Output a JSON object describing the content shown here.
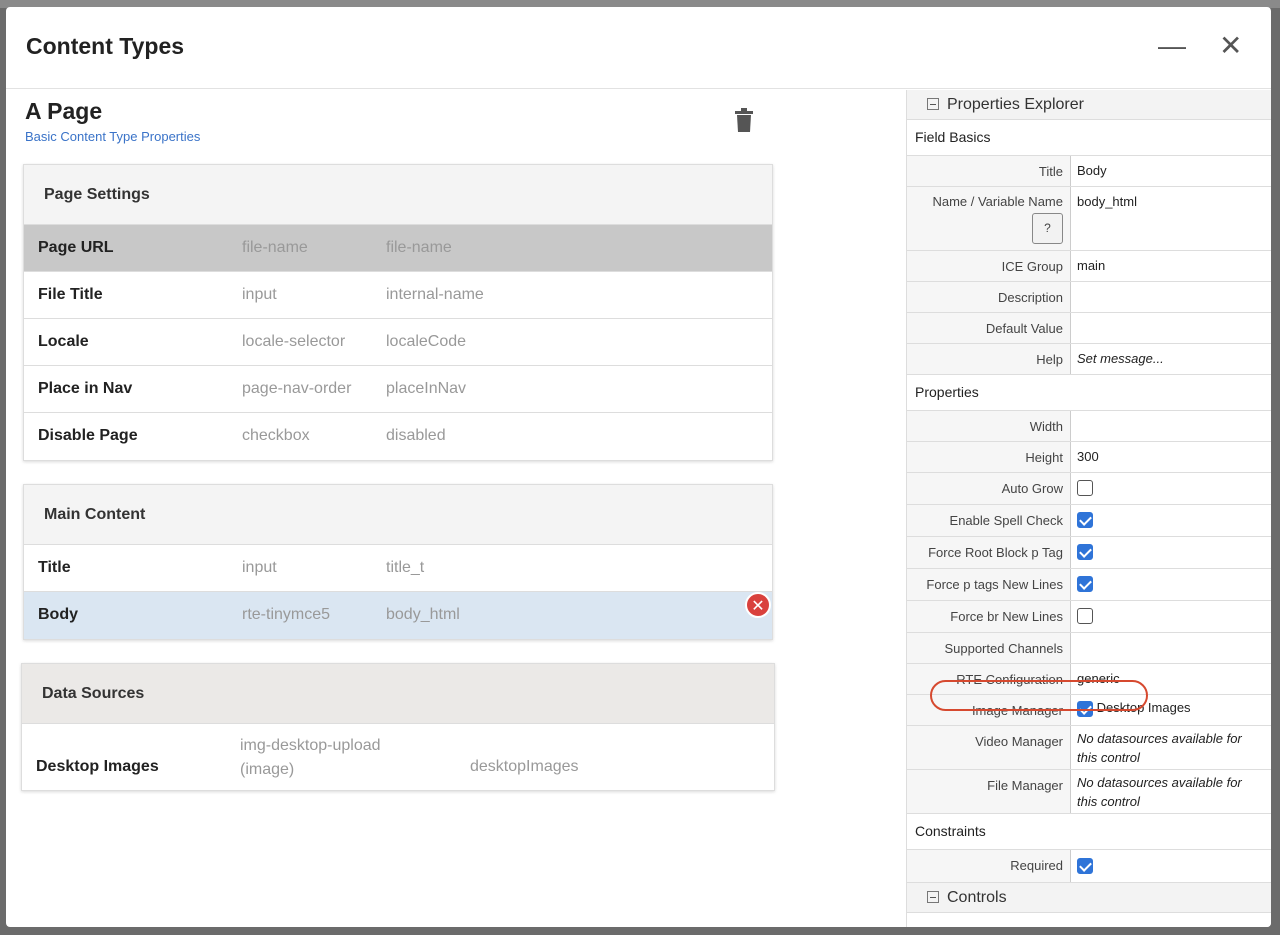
{
  "modal": {
    "title": "Content Types",
    "minimize_icon": "minus-icon",
    "close_icon": "close-icon"
  },
  "page": {
    "title": "A Page",
    "subtitle": "Basic Content Type Properties"
  },
  "sections": [
    {
      "title": "Page Settings",
      "rows": [
        [
          "Page URL",
          "file-name",
          "file-name"
        ],
        [
          "File Title",
          "input",
          "internal-name"
        ],
        [
          "Locale",
          "locale-selector",
          "localeCode"
        ],
        [
          "Place in Nav",
          "page-nav-order",
          "placeInNav"
        ],
        [
          "Disable Page",
          "checkbox",
          "disabled"
        ]
      ]
    },
    {
      "title": "Main Content",
      "rows": [
        [
          "Title",
          "input",
          "title_t"
        ],
        [
          "Body",
          "rte-tinymce5",
          "body_html"
        ]
      ]
    },
    {
      "title": "Data Sources",
      "rows": [
        [
          "Desktop Images",
          "img-desktop-upload (image)",
          "desktopImages"
        ]
      ]
    }
  ],
  "props": {
    "header": "Properties Explorer",
    "field_basics": "Field Basics",
    "title_label": "Title",
    "title_value": "Body",
    "name_label": "Name / Variable Name",
    "name_value": "body_html",
    "ice_label": "ICE Group",
    "ice_value": "main",
    "desc_label": "Description",
    "default_label": "Default Value",
    "help_label": "Help",
    "help_value": "Set message...",
    "properties": "Properties",
    "width_label": "Width",
    "height_label": "Height",
    "height_value": "300",
    "checks": [
      {
        "label": "Auto Grow",
        "checked": false
      },
      {
        "label": "Enable Spell Check",
        "checked": true
      },
      {
        "label": "Force Root Block p Tag",
        "checked": true
      },
      {
        "label": "Force p tags New Lines",
        "checked": true
      },
      {
        "label": "Force br New Lines",
        "checked": false
      }
    ],
    "channels_label": "Supported Channels",
    "rte_label": "RTE Configuration",
    "rte_value": "generic",
    "image_label": "Image Manager",
    "image_value": "Desktop Images",
    "video_label": "Video Manager",
    "video_value": "No datasources available for this control",
    "file_label": "File Manager",
    "file_value": "No datasources available for this control",
    "constraints": "Constraints",
    "required_label": "Required",
    "controls": "Controls"
  },
  "colors": {
    "accent": "#2f74d8",
    "highlight": "#d6492f",
    "link": "#3a73c8"
  }
}
